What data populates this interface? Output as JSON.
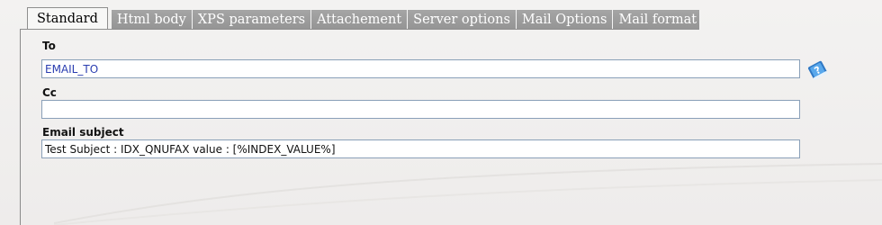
{
  "tabs": [
    {
      "label": "Standard",
      "active": true
    },
    {
      "label": "Html body",
      "active": false
    },
    {
      "label": "XPS parameters",
      "active": false
    },
    {
      "label": "Attachement",
      "active": false
    },
    {
      "label": "Server options",
      "active": false
    },
    {
      "label": "Mail Options",
      "active": false
    },
    {
      "label": "Mail format",
      "active": false
    }
  ],
  "form": {
    "to": {
      "label": "To",
      "value": "EMAIL_TO"
    },
    "cc": {
      "label": "Cc",
      "value": ""
    },
    "subject": {
      "label": "Email subject",
      "value": "Test Subject : IDX_QNUFAX value : [%INDEX_VALUE%]"
    }
  },
  "icons": {
    "help": "help-book-icon"
  },
  "colors": {
    "tab_inactive_bg": "#9c9c9c",
    "tab_active_bg": "#f7f7f6",
    "input_border": "#8aa0b8",
    "to_text": "#2a3db0",
    "help_icon": "#3f8fd2"
  }
}
